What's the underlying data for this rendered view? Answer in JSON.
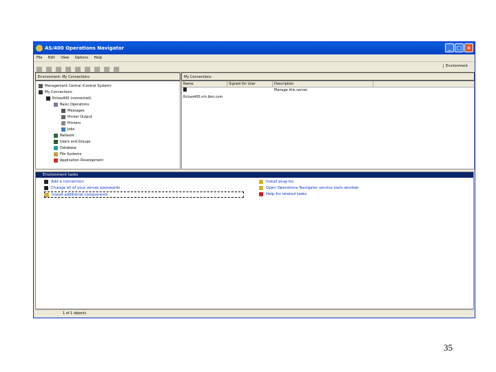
{
  "window": {
    "title": "AS/400 Operations Navigator",
    "env_label": "Environment"
  },
  "menu": [
    "File",
    "Edit",
    "View",
    "Options",
    "Help"
  ],
  "left_pane": {
    "header": "Environment: My Connections",
    "tree": [
      {
        "label": "Management Central (Central System)",
        "level": 0
      },
      {
        "label": "My Connections",
        "level": 0
      },
      {
        "label": "Rchas400 (connected)",
        "level": 1
      },
      {
        "label": "Basic Operations",
        "level": 2
      },
      {
        "label": "Messages",
        "level": 3
      },
      {
        "label": "Printer Output",
        "level": 3
      },
      {
        "label": "Printers",
        "level": 3
      },
      {
        "label": "Jobs",
        "level": 3
      },
      {
        "label": "Network",
        "level": 2
      },
      {
        "label": "Users and Groups",
        "level": 2
      },
      {
        "label": "Database",
        "level": 2
      },
      {
        "label": "File Systems",
        "level": 2
      },
      {
        "label": "Application Development",
        "level": 2
      }
    ]
  },
  "right_pane": {
    "header": "My Connections",
    "columns": [
      "Name",
      "Signed On User",
      "Description"
    ],
    "rows": [
      {
        "name": "Rchas400.rch.ibm.com",
        "user": "",
        "description": "Manage this server."
      }
    ]
  },
  "taskpad": {
    "header": "Environment tasks",
    "left": [
      "Add a connection",
      "Change all of your server passwords",
      "Install additional components"
    ],
    "right": [
      "Install plug-ins",
      "Open Operations Navigator service tools window",
      "Help for related tasks"
    ]
  },
  "status": "1 of 1 objects",
  "page_number": "35"
}
